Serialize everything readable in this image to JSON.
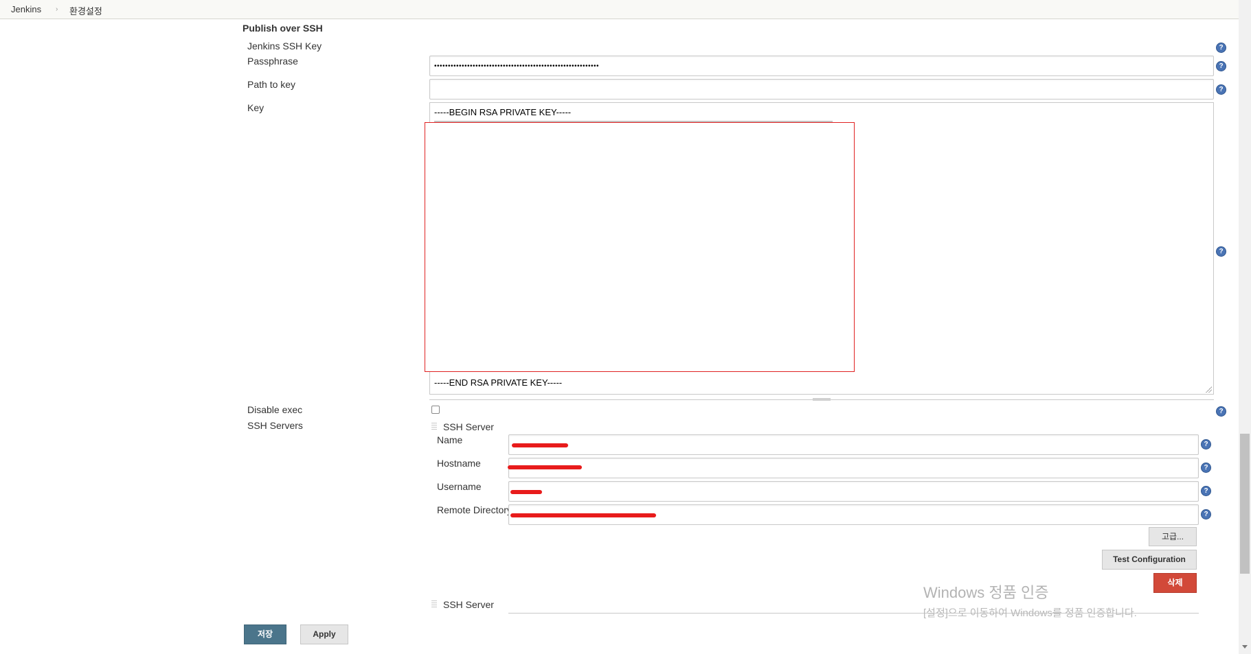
{
  "breadcrumb": {
    "items": [
      {
        "label": "Jenkins"
      },
      {
        "label": "환경설정"
      }
    ],
    "separator": "›"
  },
  "section": {
    "title": "Publish over SSH"
  },
  "jenkins_ssh_key": {
    "heading": "Jenkins SSH Key",
    "passphrase_label": "Passphrase",
    "passphrase_value": "••••••••••••••••••••••••••••••••••••••••••••••••••••••••••••",
    "path_label": "Path to key",
    "path_value": "",
    "key_label": "Key",
    "key_first_line": "-----BEGIN RSA PRIVATE KEY-----",
    "key_last_line": "-----END RSA PRIVATE KEY-----"
  },
  "disable_exec": {
    "label": "Disable exec",
    "checked": false
  },
  "ssh_servers": {
    "label": "SSH Servers",
    "servers": [
      {
        "header": "SSH Server",
        "name_label": "Name",
        "hostname_label": "Hostname",
        "username_label": "Username",
        "remote_dir_label": "Remote Directory"
      },
      {
        "header": "SSH Server"
      }
    ],
    "advanced_button": "고급...",
    "test_button": "Test Configuration",
    "delete_button": "삭제"
  },
  "footer": {
    "save_button": "저장",
    "apply_button": "Apply"
  },
  "watermark": {
    "line1": "Windows 정품 인증",
    "line2": "[설정]으로 이동하여 Windows를 정품 인증합니다."
  },
  "colors": {
    "primary_button": "#4b758b",
    "danger_button": "#d24939",
    "help_icon": "#4a74b5",
    "redaction": "#e81b1b"
  },
  "icons": {
    "help": "help-icon",
    "drag_handle": "drag-handle-icon"
  }
}
